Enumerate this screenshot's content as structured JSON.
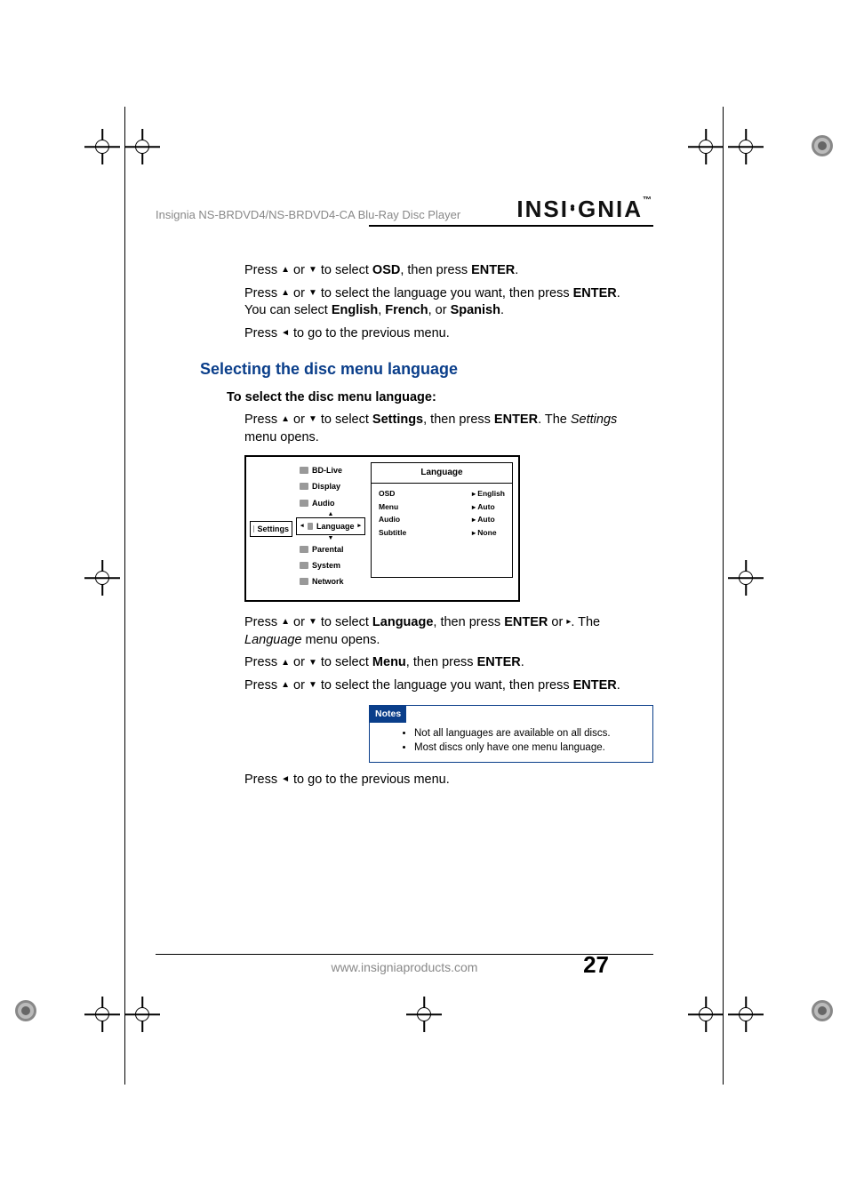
{
  "header": {
    "product_line": "Insignia NS-BRDVD4/NS-BRDVD4-CA Blu-Ray Disc Player",
    "brand": "INSIGNIA"
  },
  "intro": {
    "p1_a": "Press ",
    "p1_b": " or ",
    "p1_c": " to select ",
    "p1_bold1": "OSD",
    "p1_d": ", then press ",
    "p1_bold2": "ENTER",
    "p1_e": ".",
    "p2_a": "Press ",
    "p2_b": " or ",
    "p2_c": " to select the language you want, then press ",
    "p2_bold": "ENTER",
    "p2_d": ". You can select ",
    "p2_lang1": "English",
    "p2_sep1": ", ",
    "p2_lang2": "French",
    "p2_sep2": ", or ",
    "p2_lang3": "Spanish",
    "p2_e": ".",
    "p3_a": "Press ",
    "p3_b": " to go to the previous menu."
  },
  "section": {
    "title": "Selecting the disc menu language",
    "sub": "To select the disc menu language:",
    "s1_a": "Press ",
    "s1_b": " or ",
    "s1_c": " to select ",
    "s1_bold": "Settings",
    "s1_d": ", then press ",
    "s1_bold2": "ENTER",
    "s1_e": ". The ",
    "s1_it": "Settings",
    "s1_f": " menu opens.",
    "s2_a": "Press ",
    "s2_b": " or ",
    "s2_c": " to select ",
    "s2_bold": "Language",
    "s2_d": ", then press ",
    "s2_bold2": "ENTER",
    "s2_e": " or ",
    "s2_f": ". The ",
    "s2_it": "Language",
    "s2_g": " menu opens.",
    "s3_a": "Press ",
    "s3_b": " or ",
    "s3_c": " to select ",
    "s3_bold": "Menu",
    "s3_d": ", then press ",
    "s3_bold2": "ENTER",
    "s3_e": ".",
    "s4_a": "Press ",
    "s4_b": " or ",
    "s4_c": " to select the language you want, then press ",
    "s4_bold": "ENTER",
    "s4_d": ".",
    "s5_a": "Press ",
    "s5_b": " to go to the previous menu."
  },
  "osd": {
    "left_label": "Settings",
    "mid": [
      "BD-Live",
      "Display",
      "Audio",
      "Language",
      "Parental",
      "System",
      "Network"
    ],
    "right_title": "Language",
    "rows": [
      {
        "k": "OSD",
        "v": "English"
      },
      {
        "k": "Menu",
        "v": "Auto"
      },
      {
        "k": "Audio",
        "v": "Auto"
      },
      {
        "k": "Subtitle",
        "v": "None"
      }
    ]
  },
  "notes": {
    "label": "Notes",
    "items": [
      "Not all languages are available on all discs.",
      "Most discs only have one menu language."
    ]
  },
  "footer": {
    "url": "www.insigniaproducts.com",
    "page": "27"
  }
}
